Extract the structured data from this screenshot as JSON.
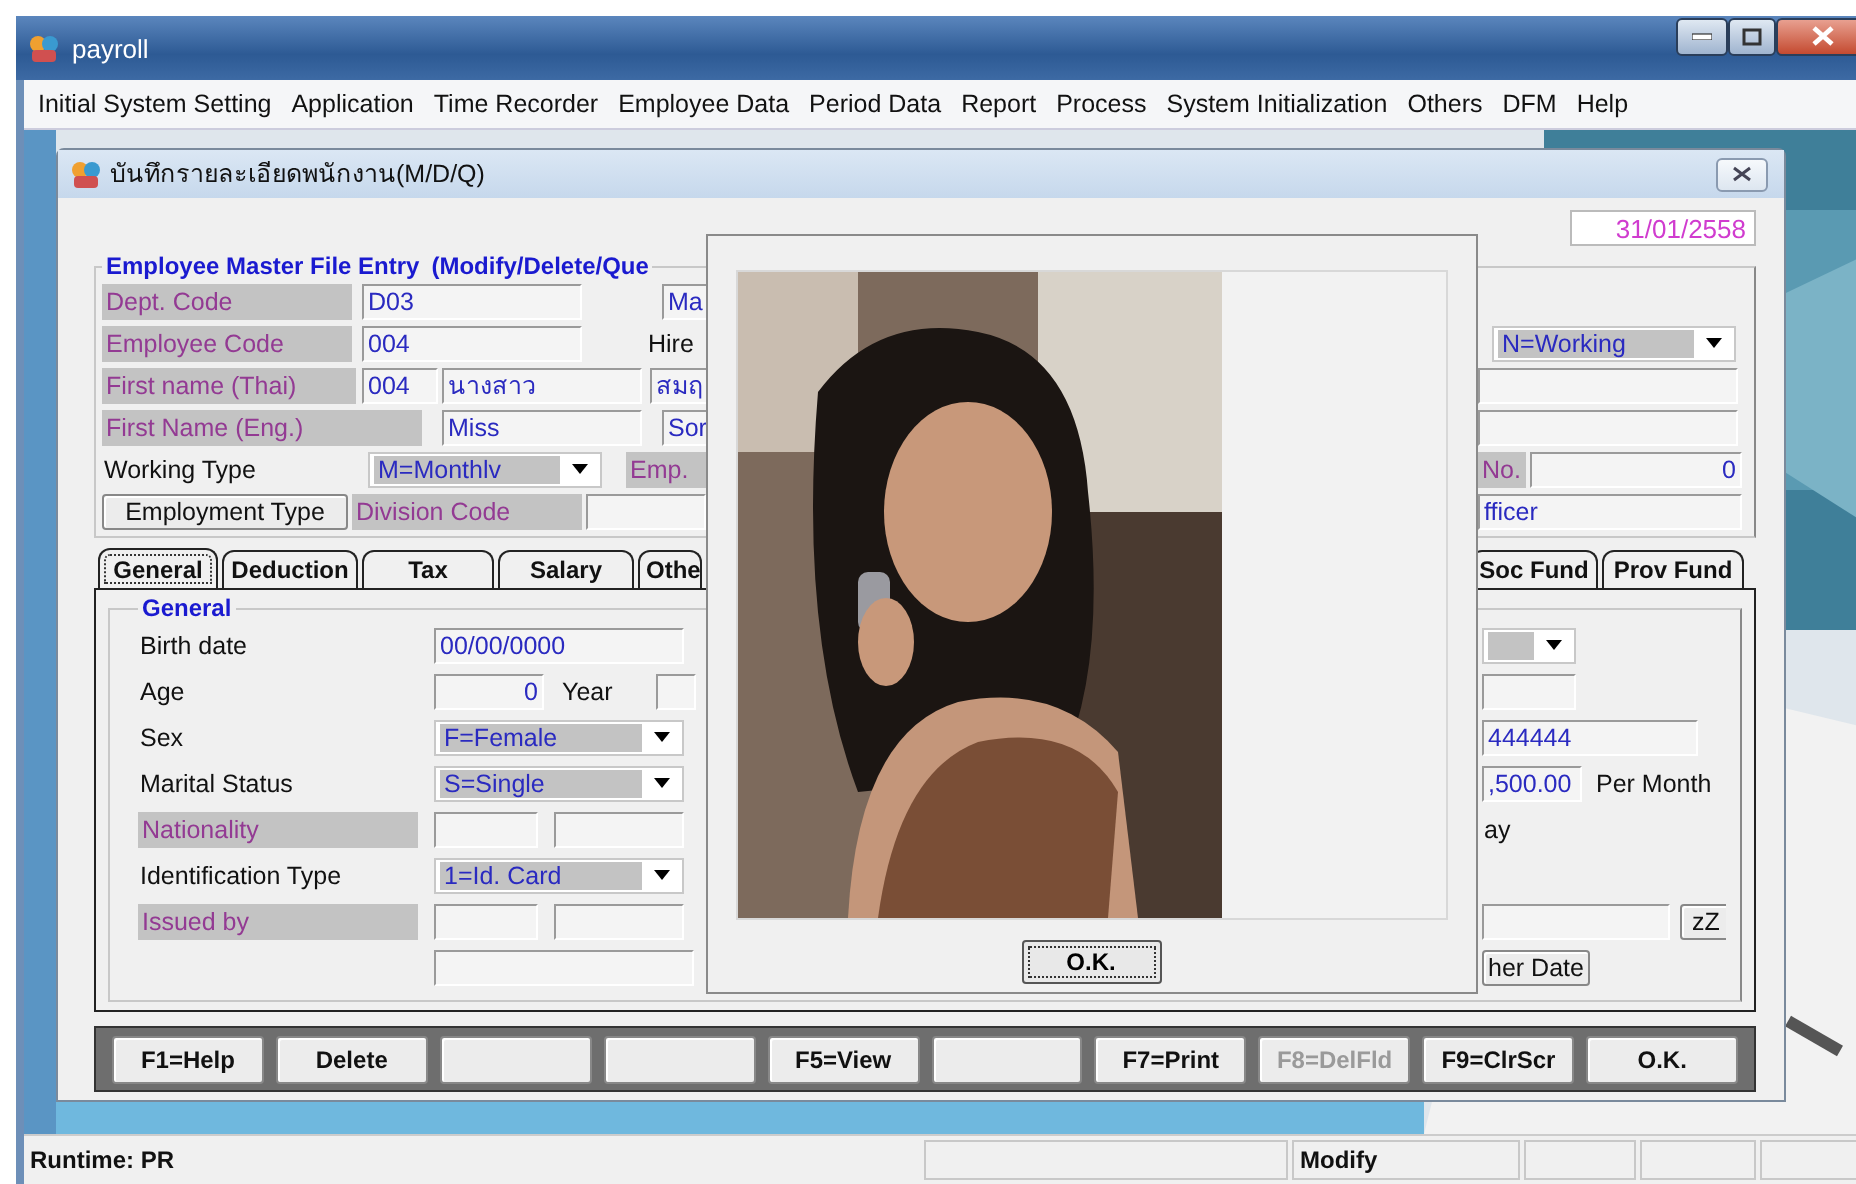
{
  "window": {
    "title": "payroll"
  },
  "menu": [
    "Initial System Setting",
    "Application",
    "Time Recorder",
    "Employee Data",
    "Period Data",
    "Report",
    "Process",
    "System Initialization",
    "Others",
    "DFM",
    "Help"
  ],
  "child_window": {
    "title": "บันทึกรายละเอียดพนักงาน(M/D/Q)",
    "date": "31/01/2558"
  },
  "form": {
    "title": "Employee Master File Entry",
    "mode": "(Modify/Delete/Que",
    "left_rows": [
      [
        {
          "kind": "tag",
          "text": "Dept. Code"
        },
        {
          "kind": "field",
          "text": "D03"
        },
        {
          "kind": "field",
          "text": "Ma"
        }
      ],
      [
        {
          "kind": "tag",
          "text": "Employee Code"
        },
        {
          "kind": "field",
          "text": "004"
        },
        {
          "kind": "text",
          "text": "Hire"
        }
      ],
      [
        {
          "kind": "tag",
          "text": "First name (Thai)"
        },
        {
          "kind": "field",
          "text": "004"
        },
        {
          "kind": "field",
          "text": "นางสาว"
        },
        {
          "kind": "field",
          "text": "สมฤ"
        }
      ],
      [
        {
          "kind": "tag",
          "text": "First Name (Eng.)"
        },
        {
          "kind": "field",
          "text": "Miss"
        },
        {
          "kind": "field",
          "text": "Sor"
        }
      ],
      [
        {
          "kind": "text",
          "text": "Working Type"
        },
        {
          "kind": "combo",
          "text": "M=Monthlv"
        },
        {
          "kind": "tag",
          "text": "Emp."
        }
      ],
      [
        {
          "kind": "button",
          "text": "Employment Type"
        },
        {
          "kind": "tag",
          "text": "Division Code"
        },
        {
          "kind": "field"
        }
      ]
    ],
    "right_rows": [
      [],
      [
        {
          "kind": "combo",
          "text": "N=Working"
        }
      ],
      [
        {
          "kind": "field"
        }
      ],
      [
        {
          "kind": "field"
        }
      ],
      [
        {
          "kind": "tag",
          "text": "No."
        },
        {
          "kind": "field",
          "text": "0"
        }
      ],
      [
        {
          "kind": "field",
          "text": "fficer"
        }
      ]
    ]
  },
  "tabs": [
    {
      "label": "General",
      "selected": true
    },
    {
      "label": "Deduction",
      "selected": false
    },
    {
      "label": "Tax",
      "selected": false
    },
    {
      "label": "Salary",
      "selected": false
    },
    {
      "label": "Othe",
      "selected": false
    },
    {
      "label": "Soc Fund",
      "selected": false
    },
    {
      "label": "Prov Fund",
      "selected": false
    }
  ],
  "panel": {
    "title": "General",
    "left_rows": [
      [
        {
          "kind": "text",
          "text": "Birth date"
        },
        {
          "kind": "field",
          "text": "00/00/0000"
        }
      ],
      [
        {
          "kind": "text",
          "text": "Age"
        },
        {
          "kind": "field",
          "text": "0"
        },
        {
          "kind": "text",
          "text": "Year"
        },
        {
          "kind": "field"
        }
      ],
      [
        {
          "kind": "text",
          "text": "Sex"
        },
        {
          "kind": "combo",
          "text": "F=Female"
        }
      ],
      [
        {
          "kind": "text",
          "text": "Marital Status"
        },
        {
          "kind": "combo",
          "text": "S=Single"
        }
      ],
      [
        {
          "kind": "tag",
          "text": "Nationality"
        },
        {
          "kind": "field"
        },
        {
          "kind": "field"
        }
      ],
      [
        {
          "kind": "text",
          "text": "Identification Type"
        },
        {
          "kind": "combo",
          "text": "1=Id. Card"
        }
      ],
      [
        {
          "kind": "tag",
          "text": "Issued by"
        },
        {
          "kind": "field"
        },
        {
          "kind": "field"
        }
      ],
      [
        {
          "kind": "field"
        }
      ]
    ],
    "right_rows": [
      [
        {
          "kind": "combo"
        }
      ],
      [
        {
          "kind": "field"
        }
      ],
      [
        {
          "kind": "field",
          "text": "444444"
        }
      ],
      [
        {
          "kind": "field",
          "text": ",500.00"
        },
        {
          "kind": "text",
          "text": "Per Month"
        }
      ],
      [
        {
          "kind": "text",
          "text": "ay"
        }
      ],
      [],
      [
        {
          "kind": "field"
        },
        {
          "kind": "button",
          "text": "zZ"
        }
      ],
      [
        {
          "kind": "button",
          "text": "her Date"
        }
      ]
    ]
  },
  "function_keys": [
    {
      "kind": "key",
      "label": "F1=Help",
      "disabled": false
    },
    {
      "kind": "key",
      "label": "Delete",
      "disabled": false
    },
    {
      "kind": "blank"
    },
    {
      "kind": "blank"
    },
    {
      "kind": "key",
      "label": "F5=View",
      "disabled": false
    },
    {
      "kind": "blank"
    },
    {
      "kind": "key",
      "label": "F7=Print",
      "disabled": false
    },
    {
      "kind": "key",
      "label": "F8=DelFld",
      "disabled": true
    },
    {
      "kind": "key",
      "label": "F9=ClrScr",
      "disabled": false
    },
    {
      "kind": "key",
      "label": "O.K.",
      "disabled": false
    }
  ],
  "photo_dialog": {
    "kind": "picture",
    "button": "O.K."
  },
  "status_bar": [
    {
      "kind": "text",
      "text": "Runtime: PR"
    },
    {
      "kind": "blank"
    },
    {
      "kind": "text",
      "text": "Modify"
    },
    {
      "kind": "blank"
    },
    {
      "kind": "blank"
    },
    {
      "kind": "blank"
    }
  ]
}
